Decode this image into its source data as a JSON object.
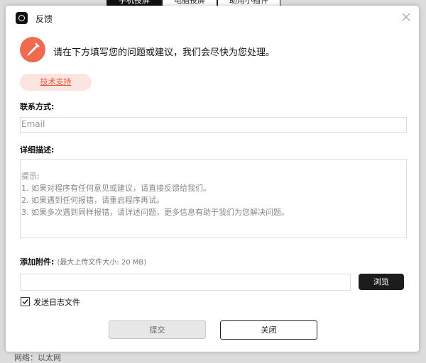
{
  "background": {
    "tabs": [
      "手机投屏",
      "电脑投屏",
      "助用小插件"
    ],
    "bottom_text": "网络：以太网"
  },
  "dialog": {
    "title": "反馈",
    "header_text": "请在下方填写您的问题或建议，我们会尽快为您处理。",
    "category_tag": "技术支持",
    "contact_label": "联系方式:",
    "email_placeholder": "Email",
    "description_label": "详细描述:",
    "description_hint": {
      "title": "提示:",
      "line1": "1. 如果对程序有任何意见或建议，请直接反馈给我们。",
      "line2": "2. 如果遇到任何报错，请重启程序再试。",
      "line3": "3. 如果多次遇到同样报错，请详述问题，更多信息有助于我们为您解决问题。"
    },
    "attachment_label": "添加附件:",
    "attachment_hint": "(最大上传文件大小: 20 MB)",
    "attachment_value": "",
    "browse_label": "浏览",
    "send_log_label": "发送日志文件",
    "send_log_checked": true,
    "submit_label": "提交",
    "cancel_label": "关闭"
  },
  "icons": {
    "app": "app-logo-icon",
    "close": "close-icon",
    "header": "pen-icon",
    "check": "checkmark-icon"
  },
  "colors": {
    "accent": "#f06a4f",
    "tag_bg": "#fce4e0",
    "tag_text": "#e8553b",
    "primary_dark": "#1c1c1c"
  }
}
